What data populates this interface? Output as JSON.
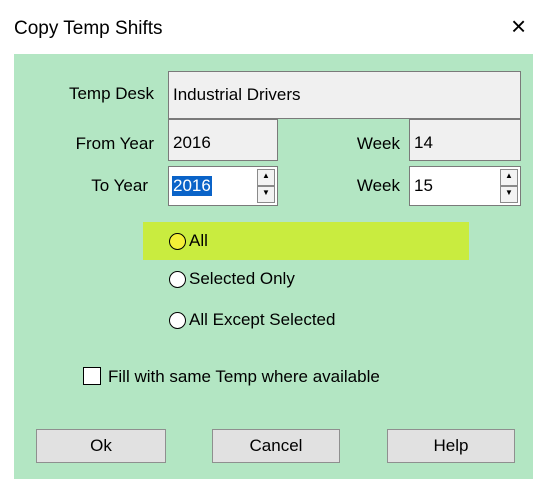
{
  "window": {
    "title": "Copy Temp Shifts",
    "close_icon": "×"
  },
  "form": {
    "temp_desk_label": "Temp Desk",
    "temp_desk_value": "Industrial Drivers",
    "from_year_label": "From Year",
    "from_year_value": "2016",
    "from_week_label": "Week",
    "from_week_value": "14",
    "to_year_label": "To Year",
    "to_year_value": "2016",
    "to_week_label": "Week",
    "to_week_value": "15",
    "spin_up": "▲",
    "spin_down": "▼"
  },
  "options": {
    "all_label": "All",
    "selected_only_label": "Selected Only",
    "all_except_label": "All Except Selected",
    "selected": "All"
  },
  "fill_checkbox": {
    "label": "Fill with same Temp where available",
    "checked": false
  },
  "buttons": {
    "ok": "Ok",
    "cancel": "Cancel",
    "help": "Help"
  },
  "colors": {
    "panel": "#b3e6c3",
    "highlight": "#c9ec3f",
    "selection": "#0a63c8"
  }
}
